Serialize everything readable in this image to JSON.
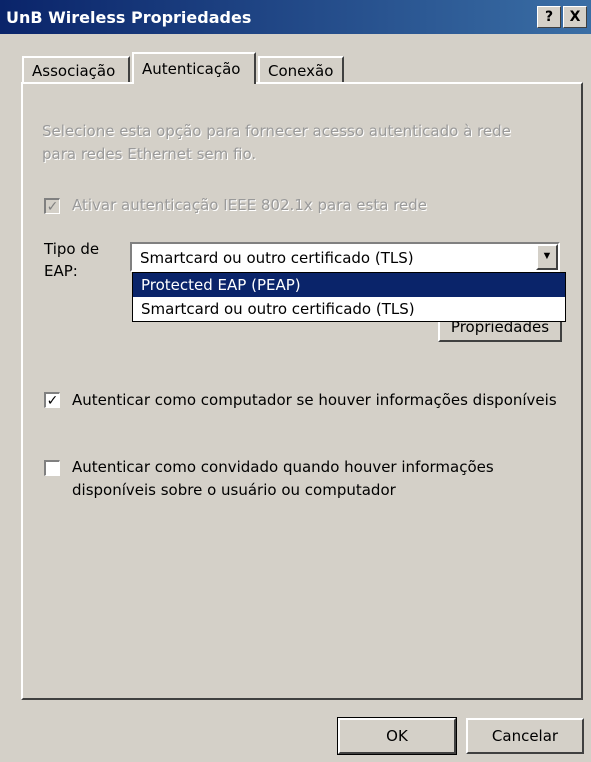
{
  "window": {
    "title": "UnB Wireless Propriedades",
    "help_label": "?",
    "close_label": "X"
  },
  "tabs": [
    {
      "label": "Associação"
    },
    {
      "label": "Autenticação"
    },
    {
      "label": "Conexão"
    }
  ],
  "auth": {
    "description_line1": "Selecione esta opção para fornecer acesso autenticado à rede",
    "description_line2": "para redes Ethernet sem fio.",
    "enable_8021x_label": "Ativar autenticação IEEE 802.1x para esta rede",
    "enable_8021x_checked": true,
    "eap_type_label_line1": "Tipo de",
    "eap_type_label_line2": "EAP:",
    "eap_selected": "Smartcard ou outro certificado (TLS)",
    "eap_options": [
      "Protected EAP (PEAP)",
      "Smartcard ou outro certificado (TLS)"
    ],
    "eap_highlighted": "Protected EAP (PEAP)",
    "properties_button": "Propriedades",
    "computer_auth_label": "Autenticar como computador se houver informações disponíveis",
    "computer_auth_checked": true,
    "guest_auth_line1": "Autenticar como convidado quando houver informações",
    "guest_auth_line2": "disponíveis sobre o usuário ou computador",
    "guest_auth_checked": false
  },
  "footer": {
    "ok_label": "OK",
    "cancel_label": "Cancelar"
  }
}
